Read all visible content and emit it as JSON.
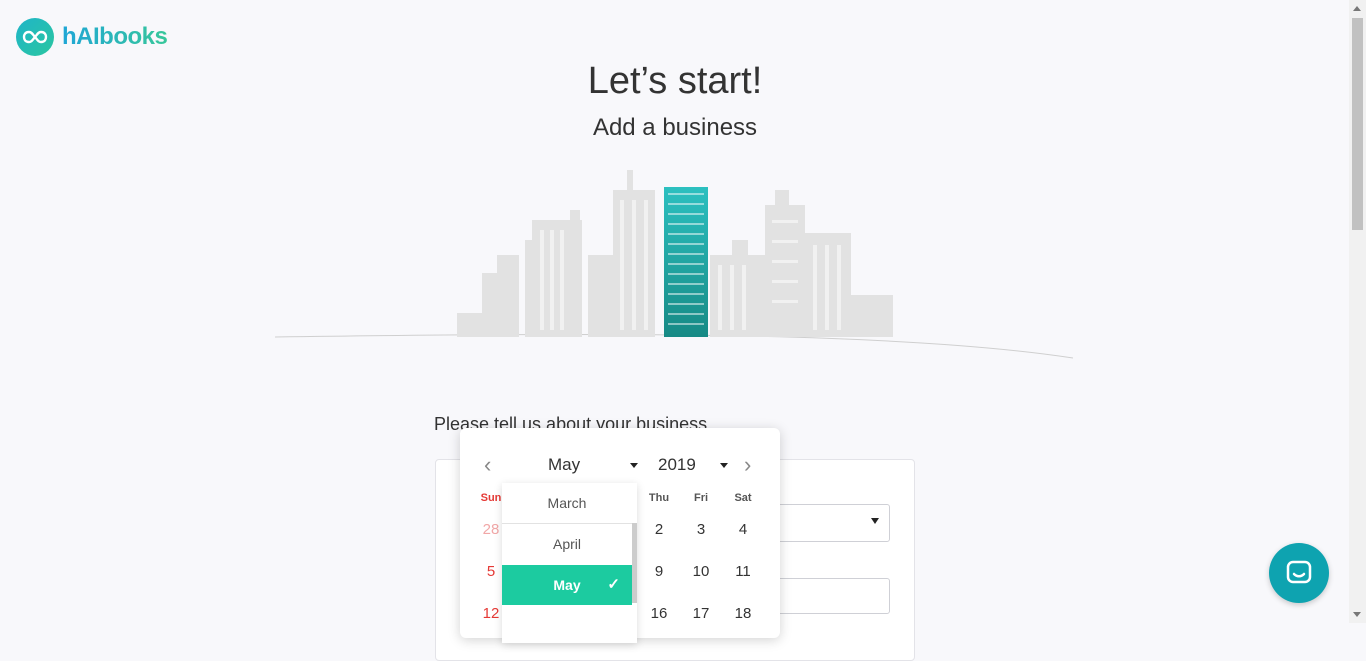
{
  "brand": {
    "name": "hAIbooks"
  },
  "hero": {
    "title": "Let’s start!",
    "subtitle": "Add a business"
  },
  "form": {
    "prompt": "Please tell us about your business"
  },
  "datepicker": {
    "month": "May",
    "year": "2019",
    "weekdays": [
      "Sun",
      "Thu",
      "Fri",
      "Sat"
    ],
    "days": {
      "row1": [
        "28",
        "2",
        "3",
        "4"
      ],
      "row2": [
        "5",
        "9",
        "10",
        "11"
      ],
      "row3": [
        "12",
        "16",
        "17",
        "18"
      ]
    },
    "month_options": [
      "March",
      "April",
      "May"
    ],
    "selected_month": "May"
  },
  "colors": {
    "accent": "#1ccba0",
    "brand_teal": "#0ea3b0",
    "weekend": "#e53935"
  },
  "icons": {
    "chat": "chat-bubble-icon",
    "prev": "chevron-left-icon",
    "next": "chevron-right-icon"
  }
}
